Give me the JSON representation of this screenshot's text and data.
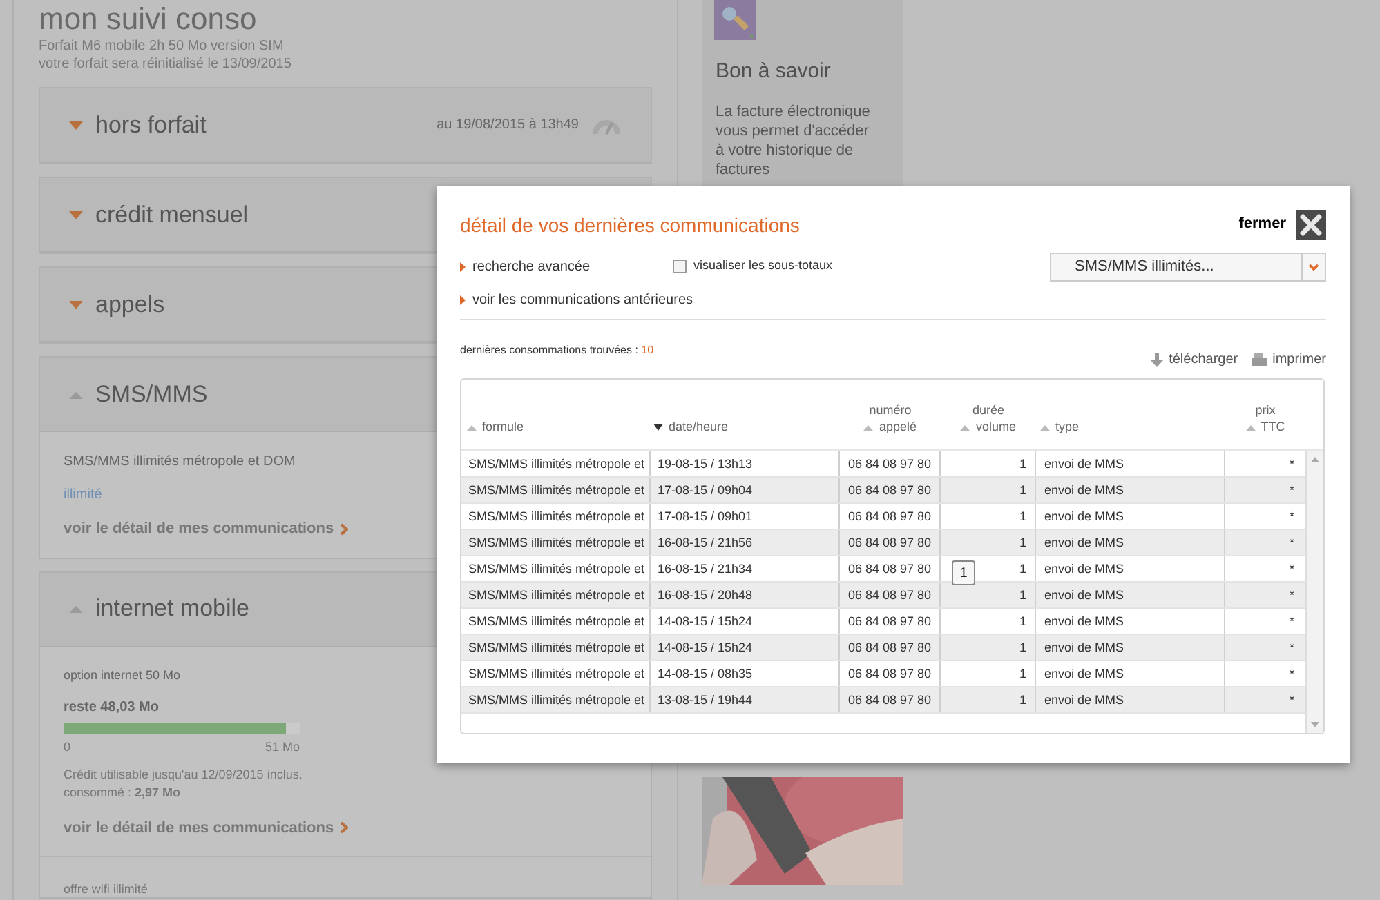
{
  "page": {
    "title": "mon suivi conso",
    "subtitle": [
      "Forfait M6 mobile 2h 50 Mo version SIM",
      "votre forfait sera réinitialisé le 13/09/2015"
    ]
  },
  "sections": [
    {
      "title": "hors forfait",
      "expanded": false,
      "meta": "au 19/08/2015 à 13h49"
    },
    {
      "title": "crédit mensuel",
      "expanded": false
    },
    {
      "title": "appels",
      "expanded": false
    },
    {
      "kind": "sms",
      "title": "SMS/MMS",
      "expanded": true,
      "plan": "SMS/MMS illimités métropole et DOM",
      "value": "illimité",
      "link": "voir le détail de mes communications"
    },
    {
      "kind": "data",
      "title": "internet mobile",
      "expanded": true,
      "plan": "option internet 50 Mo",
      "remaining": "reste 48,03 Mo",
      "level": 0.94,
      "min": "0",
      "max": "51 Mo",
      "validity": "Crédit utilisable jusqu'au 12/09/2015 inclus.",
      "consumed": "consommé : **2,97 Mo**",
      "link": "voir le détail de mes communications",
      "extra": "offre wifi illimité"
    }
  ],
  "sidebar": {
    "title": "Bon à savoir",
    "text": "La facture électronique vous permet d'accéder à votre historique de factures"
  },
  "modal": {
    "title": "détail de vos dernières communications",
    "close_label": "fermer",
    "links": [
      "recherche avancée",
      "voir les communications antérieures"
    ],
    "checkbox": {
      "label": "visualiser les sous-totaux",
      "checked": false
    },
    "select": {
      "value": "SMS/MMS illimités..."
    },
    "count_label": "dernières consommations trouvées :",
    "count": "10",
    "actions": [
      {
        "kind": "download",
        "label": "télécharger"
      },
      {
        "kind": "print",
        "label": "imprimer"
      }
    ],
    "columns": [
      {
        "label": [
          "formule"
        ],
        "sorted": false
      },
      {
        "label": [
          "date/heure"
        ],
        "sorted": true
      },
      {
        "label": [
          "numéro",
          "appelé"
        ],
        "sorted": false
      },
      {
        "label": [
          "durée",
          "volume"
        ],
        "sorted": false
      },
      {
        "label": [
          "type"
        ],
        "sorted": false
      },
      {
        "label": [
          "prix",
          "TTC"
        ],
        "sorted": false
      }
    ],
    "rows": [
      [
        "SMS/MMS illimités métropole et",
        "19-08-15 / 13h13",
        "06 84 08 97 80",
        "1",
        "envoi de MMS",
        "*"
      ],
      [
        "SMS/MMS illimités métropole et",
        "17-08-15 / 09h04",
        "06 84 08 97 80",
        "1",
        "envoi de MMS",
        "*"
      ],
      [
        "SMS/MMS illimités métropole et",
        "17-08-15 / 09h01",
        "06 84 08 97 80",
        "1",
        "envoi de MMS",
        "*"
      ],
      [
        "SMS/MMS illimités métropole et",
        "16-08-15 / 21h56",
        "06 84 08 97 80",
        "1",
        "envoi de MMS",
        "*"
      ],
      [
        "SMS/MMS illimités métropole et",
        "16-08-15 / 21h34",
        "06 84 08 97 80",
        "1",
        "envoi de MMS",
        "*"
      ],
      [
        "SMS/MMS illimités métropole et",
        "16-08-15 / 20h48",
        "06 84 08 97 80",
        "1",
        "envoi de MMS",
        "*"
      ],
      [
        "SMS/MMS illimités métropole et",
        "14-08-15 / 15h24",
        "06 84 08 97 80",
        "1",
        "envoi de MMS",
        "*"
      ],
      [
        "SMS/MMS illimités métropole et",
        "14-08-15 / 15h24",
        "06 84 08 97 80",
        "1",
        "envoi de MMS",
        "*"
      ],
      [
        "SMS/MMS illimités métropole et",
        "14-08-15 / 08h35",
        "06 84 08 97 80",
        "1",
        "envoi de MMS",
        "*"
      ],
      [
        "SMS/MMS illimités métropole et",
        "13-08-15 / 19h44",
        "06 84 08 97 80",
        "1",
        "envoi de MMS",
        "*"
      ]
    ],
    "tooltip": "1"
  }
}
